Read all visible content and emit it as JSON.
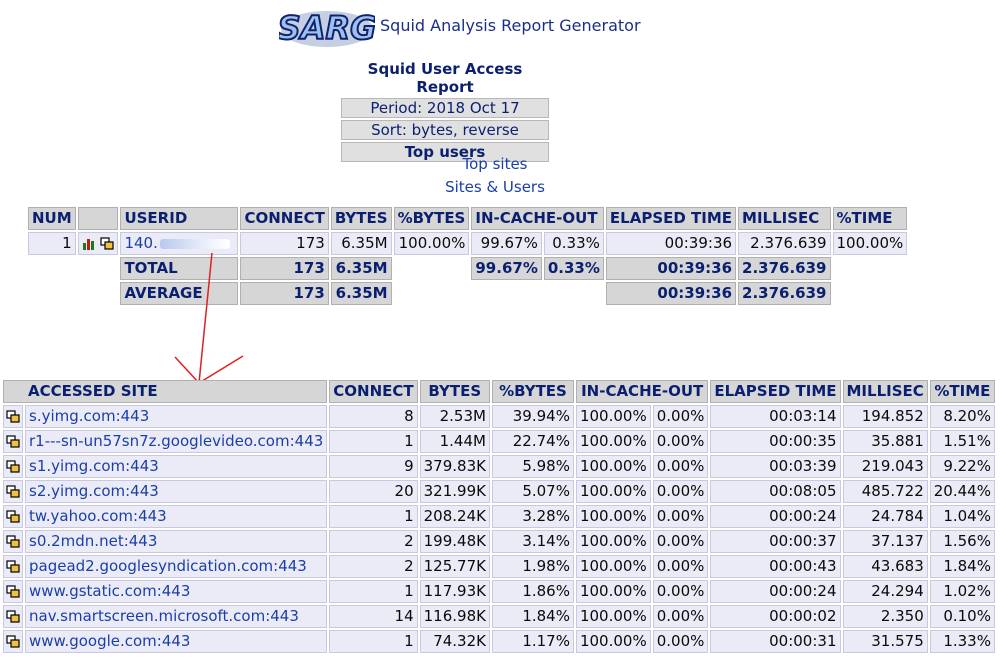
{
  "header": {
    "logo_text": "SARG",
    "app_title": "Squid Analysis Report Generator"
  },
  "report": {
    "title": "Squid User Access Report",
    "period": "Period: 2018 Oct 17",
    "sort": "Sort: bytes, reverse",
    "section": "Top users"
  },
  "links": {
    "top_sites": "Top sites",
    "sites_users": "Sites & Users"
  },
  "users_table": {
    "headers": [
      "NUM",
      "",
      "USERID",
      "CONNECT",
      "BYTES",
      "%BYTES",
      "IN-CACHE-OUT",
      "ELAPSED TIME",
      "MILLISEC",
      "%TIME"
    ],
    "row": {
      "num": "1",
      "userid": "140.",
      "connect": "173",
      "bytes": "6.35M",
      "pct_bytes": "100.00%",
      "in_cache": "99.67%",
      "out_cache": "0.33%",
      "elapsed": "00:39:36",
      "millisec": "2.376.639",
      "pct_time": "100.00%"
    },
    "total": {
      "label": "TOTAL",
      "connect": "173",
      "bytes": "6.35M",
      "in_cache": "99.67%",
      "out_cache": "0.33%",
      "elapsed": "00:39:36",
      "millisec": "2.376.639"
    },
    "average": {
      "label": "AVERAGE",
      "connect": "173",
      "bytes": "6.35M",
      "elapsed": "00:39:36",
      "millisec": "2.376.639"
    }
  },
  "sites_table": {
    "headers": {
      "site": "ACCESSED SITE",
      "connect": "CONNECT",
      "bytes": "BYTES",
      "pct_bytes": "%BYTES",
      "in_cache_out": "IN-CACHE-OUT",
      "elapsed": "ELAPSED TIME",
      "millisec": "MILLISEC",
      "pct_time": "%TIME"
    },
    "rows": [
      [
        "s.yimg.com:443",
        "8",
        "2.53M",
        "39.94%",
        "100.00%",
        "0.00%",
        "00:03:14",
        "194.852",
        "8.20%"
      ],
      [
        "r1---sn-un57sn7z.googlevideo.com:443",
        "1",
        "1.44M",
        "22.74%",
        "100.00%",
        "0.00%",
        "00:00:35",
        "35.881",
        "1.51%"
      ],
      [
        "s1.yimg.com:443",
        "9",
        "379.83K",
        "5.98%",
        "100.00%",
        "0.00%",
        "00:03:39",
        "219.043",
        "9.22%"
      ],
      [
        "s2.yimg.com:443",
        "20",
        "321.99K",
        "5.07%",
        "100.00%",
        "0.00%",
        "00:08:05",
        "485.722",
        "20.44%"
      ],
      [
        "tw.yahoo.com:443",
        "1",
        "208.24K",
        "3.28%",
        "100.00%",
        "0.00%",
        "00:00:24",
        "24.784",
        "1.04%"
      ],
      [
        "s0.2mdn.net:443",
        "2",
        "199.48K",
        "3.14%",
        "100.00%",
        "0.00%",
        "00:00:37",
        "37.137",
        "1.56%"
      ],
      [
        "pagead2.googlesyndication.com:443",
        "2",
        "125.77K",
        "1.98%",
        "100.00%",
        "0.00%",
        "00:00:43",
        "43.683",
        "1.84%"
      ],
      [
        "www.gstatic.com:443",
        "1",
        "117.93K",
        "1.86%",
        "100.00%",
        "0.00%",
        "00:00:24",
        "24.294",
        "1.02%"
      ],
      [
        "nav.smartscreen.microsoft.com:443",
        "14",
        "116.98K",
        "1.84%",
        "100.00%",
        "0.00%",
        "00:00:02",
        "2.350",
        "0.10%"
      ],
      [
        "www.google.com:443",
        "1",
        "74.32K",
        "1.17%",
        "100.00%",
        "0.00%",
        "00:00:31",
        "31.575",
        "1.33%"
      ]
    ]
  }
}
